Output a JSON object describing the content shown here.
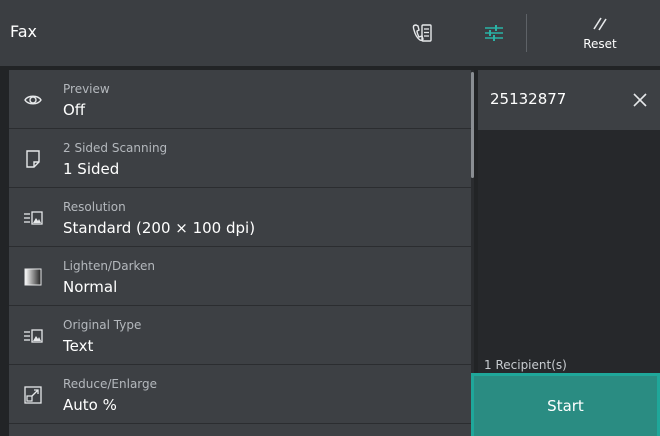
{
  "header": {
    "title": "Fax",
    "reset_label": "Reset",
    "icons": [
      "address-book-icon",
      "sliders-icon",
      "reset-icon"
    ]
  },
  "features": [
    {
      "label": "Preview",
      "value": "Off",
      "icon": "eye-icon"
    },
    {
      "label": "2 Sided Scanning",
      "value": "1 Sided",
      "icon": "page-icon"
    },
    {
      "label": "Resolution",
      "value": "Standard (200 × 100 dpi)",
      "icon": "resolution-icon"
    },
    {
      "label": "Lighten/Darken",
      "value": "Normal",
      "icon": "gradient-icon"
    },
    {
      "label": "Original Type",
      "value": "Text",
      "icon": "original-type-icon"
    },
    {
      "label": "Reduce/Enlarge",
      "value": "Auto %",
      "icon": "reduce-enlarge-icon"
    }
  ],
  "recipients": {
    "items": [
      {
        "number": "25132877"
      }
    ],
    "count_label": "1 Recipient(s)"
  },
  "start": {
    "label": "Start"
  },
  "colors": {
    "accent": "#2a8c82",
    "accent_border": "#1fa79a",
    "header_bg": "#3b3e42",
    "panel_bg": "#3d4044"
  }
}
